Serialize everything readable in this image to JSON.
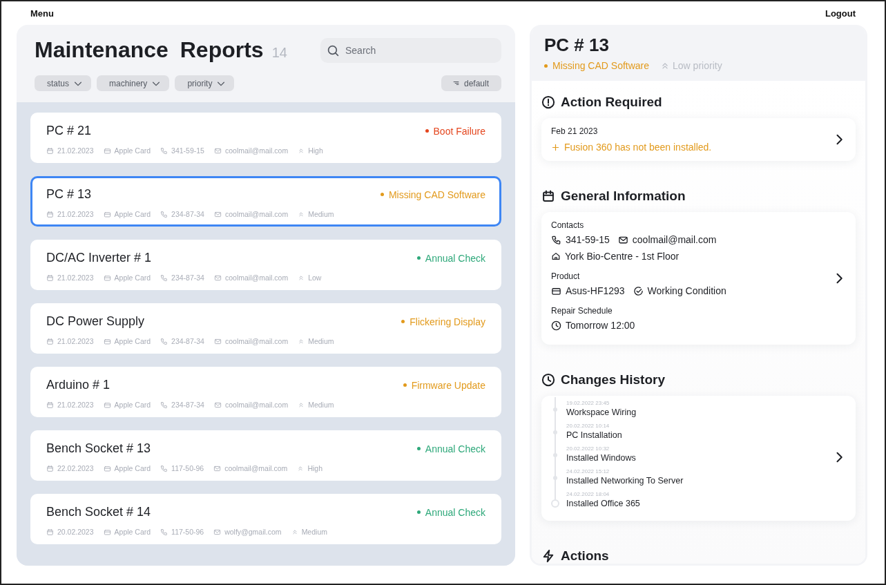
{
  "top_bar": {
    "menu": "Menu",
    "logout": "Logout"
  },
  "reports": {
    "title": "Maintenance Reports",
    "count": "14",
    "search": {
      "placeholder": "Search"
    },
    "filters": [
      "status",
      "machinery",
      "priority"
    ],
    "sort": "default",
    "items": [
      {
        "name": "PC # 21",
        "status": "Boot Failure",
        "color": "#e4461e",
        "date": "21.02.2023",
        "payment": "Apple Card",
        "phone": "341-59-15",
        "email": "coolmail@mail.com",
        "priority": "High",
        "selected": false
      },
      {
        "name": "PC # 13",
        "status": "Missing CAD Software",
        "color": "#e29a1c",
        "date": "21.02.2023",
        "payment": "Apple Card",
        "phone": "234-87-34",
        "email": "coolmail@mail.com",
        "priority": "Medium",
        "selected": true
      },
      {
        "name": "DC/AC Inverter # 1",
        "status": "Annual Check",
        "color": "#2ea87a",
        "date": "21.02.2023",
        "payment": "Apple Card",
        "phone": "234-87-34",
        "email": "coolmail@mail.com",
        "priority": "Low",
        "selected": false
      },
      {
        "name": "DC Power Supply",
        "status": "Flickering Display",
        "color": "#e29a1c",
        "date": "21.02.2023",
        "payment": "Apple Card",
        "phone": "234-87-34",
        "email": "coolmail@mail.com",
        "priority": "Medium",
        "selected": false
      },
      {
        "name": "Arduino # 1",
        "status": "Firmware Update",
        "color": "#e29a1c",
        "date": "21.02.2023",
        "payment": "Apple Card",
        "phone": "234-87-34",
        "email": "coolmail@mail.com",
        "priority": "Medium",
        "selected": false
      },
      {
        "name": "Bench Socket # 13",
        "status": "Annual Check",
        "color": "#2ea87a",
        "date": "22.02.2023",
        "payment": "Apple Card",
        "phone": "117-50-96",
        "email": "coolmail@mail.com",
        "priority": "High",
        "selected": false
      },
      {
        "name": "Bench Socket # 14",
        "status": "Annual Check",
        "color": "#2ea87a",
        "date": "20.02.2023",
        "payment": "Apple Card",
        "phone": "117-50-96",
        "email": "wolfy@gmail.com",
        "priority": "Medium",
        "selected": false
      }
    ]
  },
  "detail": {
    "title": "PC # 13",
    "status": "Missing CAD Software",
    "color": "#e29a1c",
    "priority": "Low priority",
    "action_required": {
      "heading": "Action Required",
      "date": "Feb 21 2023",
      "message": "Fusion 360 has not been installed."
    },
    "general_information": {
      "heading": "General Information",
      "contacts_label": "Contacts",
      "phone": "341-59-15",
      "email": "coolmail@mail.com",
      "location": "York Bio-Centre - 1st Floor",
      "product_label": "Product",
      "product": "Asus-HF1293",
      "condition": "Working Condition",
      "schedule_label": "Repair Schedule",
      "schedule": "Tomorrow 12:00"
    },
    "changes_history": {
      "heading": "Changes History",
      "entries": [
        {
          "time": "19.02.2022 23:45",
          "text": "Workspace Wiring",
          "current": false
        },
        {
          "time": "20.02.2022 10:14",
          "text": "PC Installation",
          "current": false
        },
        {
          "time": "20.02.2022 10:32",
          "text": "Installed Windows",
          "current": false
        },
        {
          "time": "24.02.2022 15:12",
          "text": "Installed Networking To Server",
          "current": false
        },
        {
          "time": "24.02.2022 18:04",
          "text": "Installed Office 365",
          "current": true
        }
      ]
    },
    "actions": {
      "heading": "Actions"
    }
  }
}
